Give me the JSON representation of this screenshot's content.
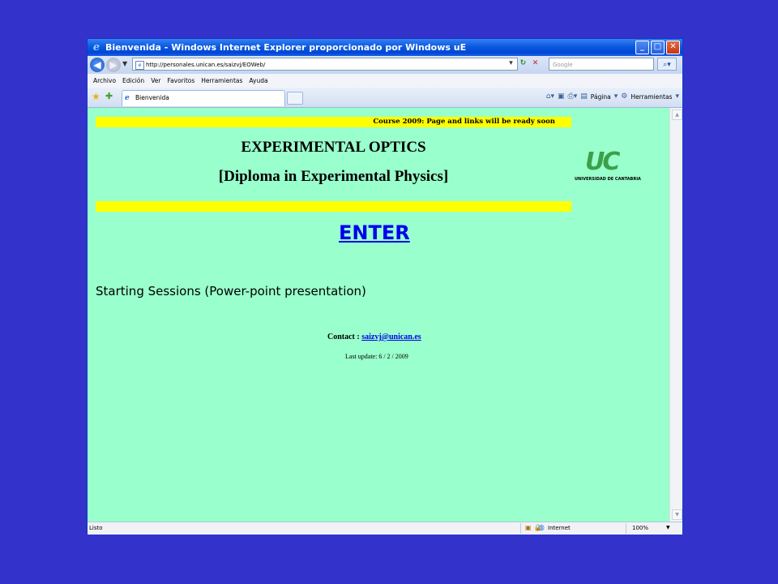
{
  "window": {
    "title": "Bienvenida - Windows Internet Explorer proporcionado por Windows uE",
    "min": "_",
    "max": "□",
    "close": "✕"
  },
  "address": {
    "url": "http://personales.unican.es/saizvj/EOWeb/",
    "search_placeholder": "Google"
  },
  "menu": [
    "Archivo",
    "Edición",
    "Ver",
    "Favoritos",
    "Herramientas",
    "Ayuda"
  ],
  "tab": {
    "title": "Bienvenida"
  },
  "commandbar": {
    "page": "Página",
    "tools": "Herramientas"
  },
  "page": {
    "course_notice": "Course 2009: Page and links will be ready soon",
    "title1": "EXPERIMENTAL OPTICS",
    "title2": "[Diploma in Experimental Physics]",
    "logo_letters": "UC",
    "logo_sub": "UNIVERSIDAD DE CANTABRIA",
    "enter": "ENTER",
    "sessions": "Starting Sessions (Power-point presentation)",
    "contact_label": "Contact : ",
    "contact_email": "saizvj@unican.es ",
    "last_update": "Last update: 6 / 2 / 2009"
  },
  "status": {
    "text": "Listo",
    "zone": "Internet",
    "zoom": "100%"
  },
  "colors": {
    "background": "#3333cc",
    "page_bg": "#99ffcc",
    "bar": "#ffff00",
    "link": "#0000ee",
    "logo_green": "#3ca04a"
  }
}
